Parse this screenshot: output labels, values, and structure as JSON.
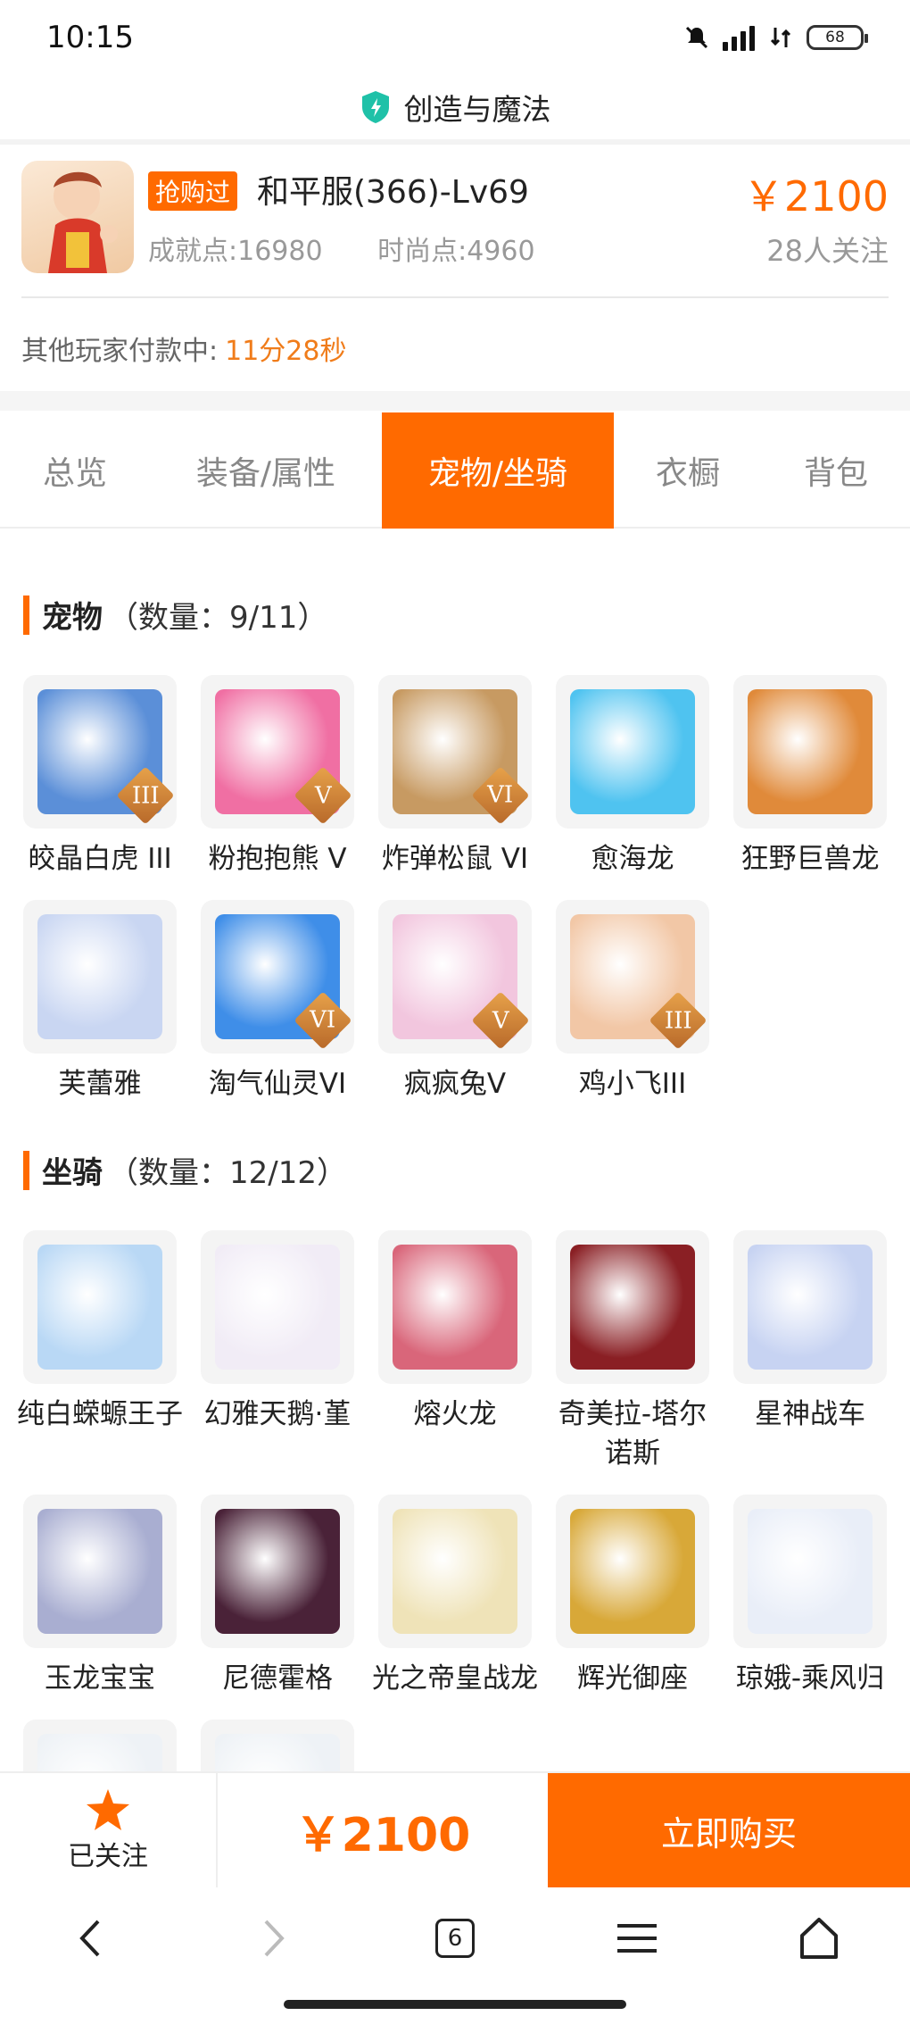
{
  "status_bar": {
    "time": "10:15",
    "battery": "68"
  },
  "app": {
    "title": "创造与魔法"
  },
  "product": {
    "badge": "抢购过",
    "name": "和平服(366)-Lv69",
    "achievement": "成就点:16980",
    "fashion": "时尚点:4960",
    "price": "￥2100",
    "followers": "28人关注",
    "payment_label": "其他玩家付款中:",
    "payment_countdown": "11分28秒"
  },
  "tabs": [
    {
      "label": "总览",
      "active": false
    },
    {
      "label": "装备/属性",
      "active": false
    },
    {
      "label": "宠物/坐骑",
      "active": true
    },
    {
      "label": "衣橱",
      "active": false
    },
    {
      "label": "背包",
      "active": false
    }
  ],
  "pets": {
    "title": "宠物",
    "count": "（数量：9/11）",
    "items": [
      {
        "name": "皎晶白虎 III",
        "tier": "III",
        "color": "#5b8fd8"
      },
      {
        "name": "粉抱抱熊 V",
        "tier": "V",
        "color": "#f06fa3"
      },
      {
        "name": "炸弹松鼠 VI",
        "tier": "VI",
        "color": "#c79a62"
      },
      {
        "name": "愈海龙",
        "tier": "",
        "color": "#4fc3f0"
      },
      {
        "name": "狂野巨兽龙",
        "tier": "",
        "color": "#e08a3a"
      },
      {
        "name": "芙蕾雅",
        "tier": "",
        "color": "#c9d6f2"
      },
      {
        "name": "淘气仙灵VI",
        "tier": "VI",
        "color": "#3f8ee8"
      },
      {
        "name": "疯疯兔V",
        "tier": "V",
        "color": "#f2c6de"
      },
      {
        "name": "鸡小飞III",
        "tier": "III",
        "color": "#f2c7a6"
      }
    ]
  },
  "mounts": {
    "title": "坐骑",
    "count": "（数量：12/12）",
    "items": [
      {
        "name": "纯白蝾螈王子",
        "color": "#b9d8f5"
      },
      {
        "name": "幻雅天鹅·堇",
        "color": "#f1ecf6"
      },
      {
        "name": "熔火龙",
        "color": "#d9667a"
      },
      {
        "name": "奇美拉-塔尔诺斯",
        "color": "#8a1f24"
      },
      {
        "name": "星神战车",
        "color": "#c7d3f2"
      },
      {
        "name": "玉龙宝宝",
        "color": "#a9aed1"
      },
      {
        "name": "尼德霍格",
        "color": "#4a2238"
      },
      {
        "name": "光之帝皇战龙",
        "color": "#efe3b8"
      },
      {
        "name": "辉光御座",
        "color": "#d8a838"
      },
      {
        "name": "琼娥-乘风归",
        "color": "#e9eef8"
      },
      {
        "name": "",
        "color": "#eef2f6"
      },
      {
        "name": "",
        "color": "#eef2f6"
      }
    ]
  },
  "bottom_bar": {
    "follow_label": "已关注",
    "price": "￥2100",
    "buy_label": "立即购买"
  },
  "nav": {
    "tab_count": "6"
  },
  "colors": {
    "accent": "#ff6a00"
  }
}
